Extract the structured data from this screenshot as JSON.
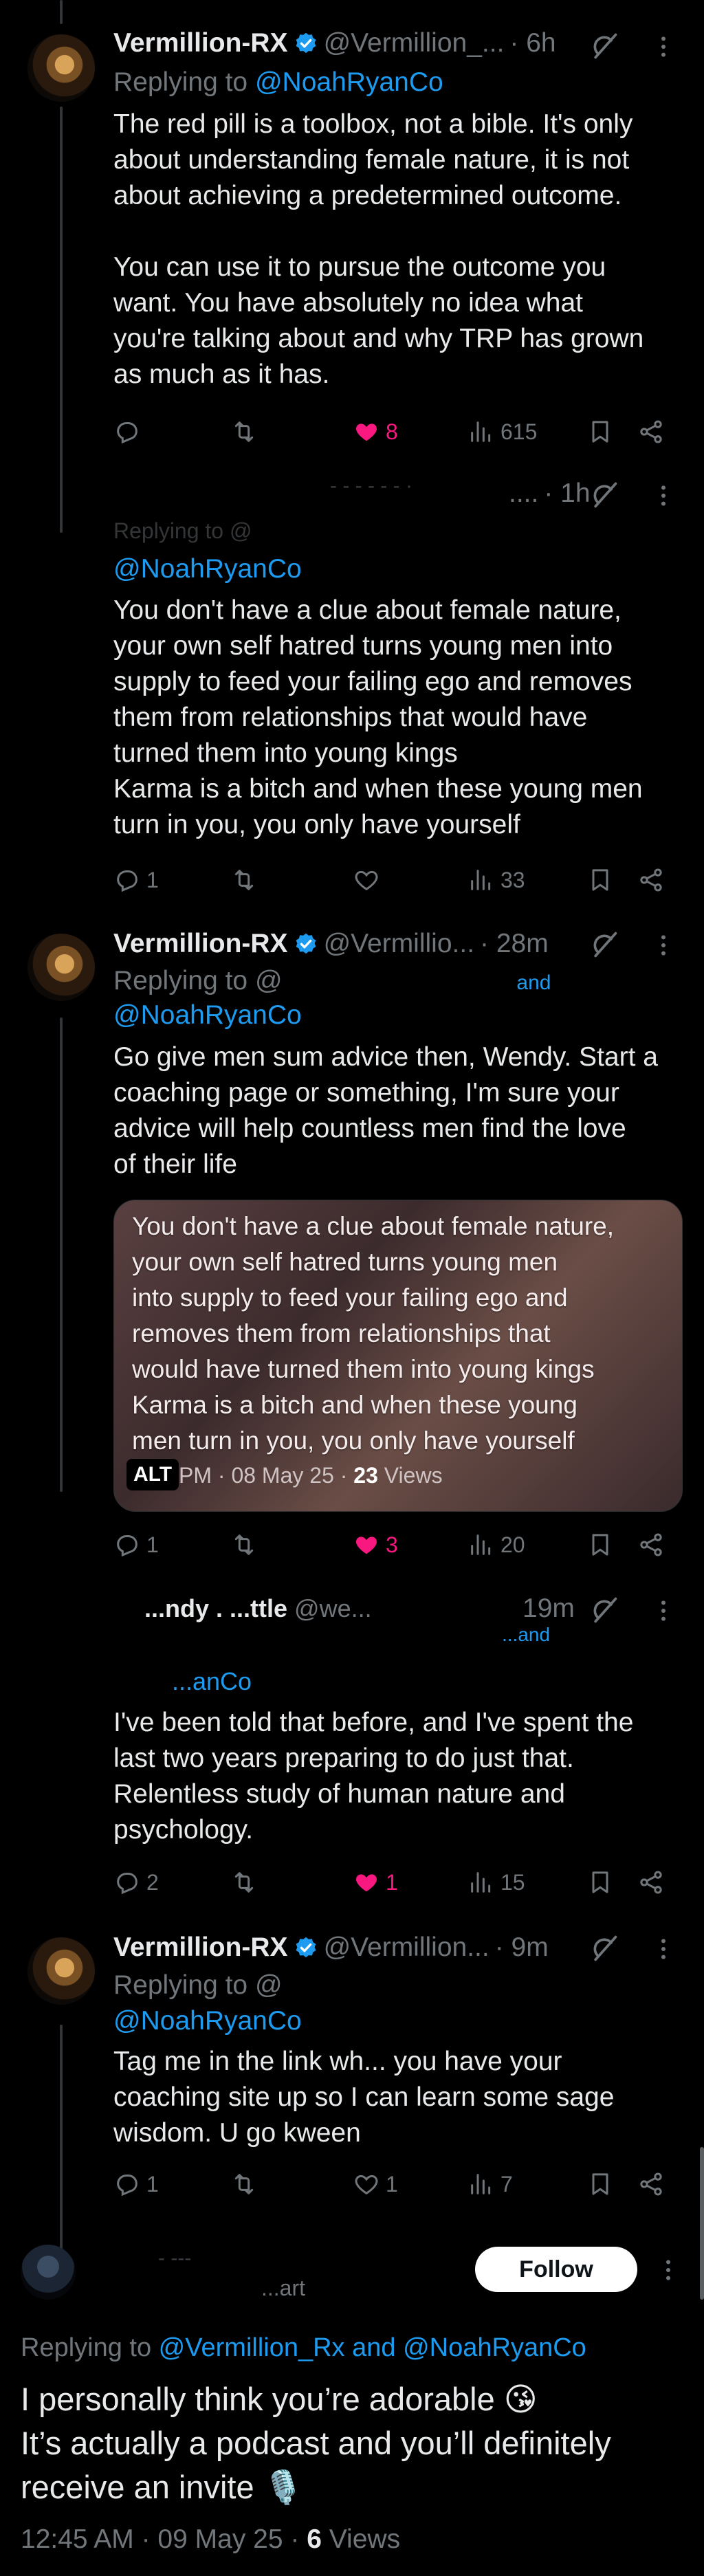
{
  "tweet1": {
    "display_name": "Vermillion-RX",
    "handle": "@Vermillion_...",
    "time": "· 6h",
    "replying_to_label": "Replying to",
    "replying_to": "@NoahRyanCo",
    "text": "The red pill is a toolbox, not a bible. It's only\nabout understanding female nature, it is not\nabout achieving a predetermined outcome.\n\nYou can use it to pursue the outcome you\nwant. You have absolutely no idea what\nyou're talking about and why TRP has grown\nas much as it has.",
    "likes": "8",
    "views": "615"
  },
  "tweet2": {
    "header_partial": "....",
    "time": "· 1h",
    "replying_to_partial": "Replying to @",
    "replying_to": "@NoahRyanCo",
    "text": "You don't have a clue about female nature,\nyour own self hatred turns young men into\nsupply to feed your failing ego and removes\nthem from relationships that would have\nturned them into young kings\nKarma is a bitch and when these young men\nturn in you, you only have yourself",
    "replies": "1",
    "views": "33"
  },
  "tweet3": {
    "display_name": "Vermillion-RX",
    "handle": "@Vermillio...",
    "time": "· 28m",
    "replying_to_label": "Replying to @",
    "replying_to_partial": "and",
    "replying_to": "@NoahRyanCo",
    "text": "Go give men sum advice then, Wendy. Start a\ncoaching page or something, I'm sure your\nadvice will help countless men find the love\nof their life",
    "quote_text": "You don't have a clue about female nature,\nyour own self hatred turns young men\ninto supply to feed your failing ego and\nremoves them from relationships that\nwould have turned them into young kings\nKarma is a bitch and when these young\nmen turn in you, you only have yourself",
    "quote_alt": "ALT",
    "quote_meta": "PM · 08 May 25 · ",
    "quote_views_count": "23",
    "quote_views_label": " Views",
    "replies": "1",
    "likes": "3",
    "views": "20"
  },
  "tweet4": {
    "display_name_partial": "...ndy . ...ttle",
    "handle": "@we...",
    "time": "19m",
    "replying_to_partial": "...and",
    "replying_to": "...anCo",
    "text": "I've been told that before, and I've spent the\nlast two years preparing to do just that.\nRelentless study of human nature and\npsychology.",
    "replies": "2",
    "likes": "1",
    "views": "15"
  },
  "tweet5": {
    "display_name": "Vermillion-RX",
    "handle": "@Vermillion...",
    "time": "· 9m",
    "replying_to_label": "Replying to @",
    "replying_to": "@NoahRyanCo",
    "text": "Tag me in the link wh... you have your\ncoaching site up so I can learn some sage\nwisdom. U go kween",
    "replies": "1",
    "likes": "1",
    "views": "7"
  },
  "main_tweet": {
    "handle_partial": "...art",
    "follow_label": "Follow",
    "replying_label": "Replying to ",
    "replying_to_1": "@Vermillion_Rx",
    "replying_and": " and ",
    "replying_to_2": "@NoahRyanCo",
    "text": "I personally think you’re adorable 😘\nIt’s actually a podcast and you’ll definitely\nreceive an invite 🎙️",
    "timestamp": "12:45 AM · 09 May 25 · ",
    "views_count": "6",
    "views_label": " Views"
  },
  "icons": {
    "reply": "reply-icon",
    "retweet": "retweet-icon",
    "like": "heart-icon",
    "views": "views-icon",
    "bookmark": "bookmark-icon",
    "share": "share-icon",
    "grok": "grok-icon",
    "more": "more-icon",
    "verified": "verified-badge-icon"
  },
  "colors": {
    "background": "#000000",
    "text": "#e7e9ea",
    "muted": "#71767b",
    "link": "#1d9bf0",
    "like": "#f91880",
    "verified": "#1d9bf0"
  }
}
